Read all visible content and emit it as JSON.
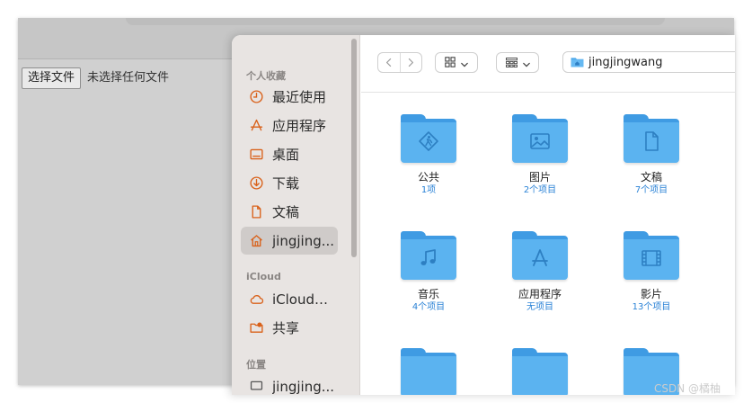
{
  "page": {
    "file_button_label": "选择文件",
    "file_status": "未选择任何文件",
    "watermark": "CSDN @橘柚 "
  },
  "sidebar": {
    "section_favorites": "个人收藏",
    "section_icloud": "iCloud",
    "section_locations": "位置",
    "favorites": [
      {
        "label": "最近使用",
        "icon": "clock-icon"
      },
      {
        "label": "应用程序",
        "icon": "apps-icon"
      },
      {
        "label": "桌面",
        "icon": "desktop-icon"
      },
      {
        "label": "下载",
        "icon": "download-icon"
      },
      {
        "label": "文稿",
        "icon": "document-icon"
      },
      {
        "label": "jingjing...",
        "icon": "home-icon",
        "selected": true
      }
    ],
    "icloud": [
      {
        "label": "iCloud…",
        "icon": "cloud-icon"
      },
      {
        "label": "共享",
        "icon": "shared-folder-icon"
      }
    ],
    "locations": [
      {
        "label": "jingjing...",
        "icon": "computer-icon"
      }
    ]
  },
  "toolbar": {
    "back_icon": "chevron-left-icon",
    "forward_icon": "chevron-right-icon",
    "view_icon": "icon-grid-icon",
    "group_icon": "list-grid-icon",
    "path_label": "jingjingwang"
  },
  "items": [
    {
      "name": "公共",
      "count": "1项",
      "icon": "public-icon"
    },
    {
      "name": "图片",
      "count": "2个项目",
      "icon": "picture-icon"
    },
    {
      "name": "文稿",
      "count": "7个项目",
      "icon": "document-icon"
    },
    {
      "name": "音乐",
      "count": "4个项目",
      "icon": "music-icon"
    },
    {
      "name": "应用程序",
      "count": "无项目",
      "icon": "apps-icon"
    },
    {
      "name": "影片",
      "count": "13个项目",
      "icon": "film-icon"
    },
    {
      "name": "",
      "count": "",
      "icon": "folder-icon"
    },
    {
      "name": "",
      "count": "",
      "icon": "folder-icon"
    },
    {
      "name": "",
      "count": "",
      "icon": "folder-icon"
    }
  ],
  "colors": {
    "accent": "#d9611a",
    "folder": "#5bb3f0",
    "folder_dark": "#3f9be3",
    "count_text": "#2a82d6"
  }
}
